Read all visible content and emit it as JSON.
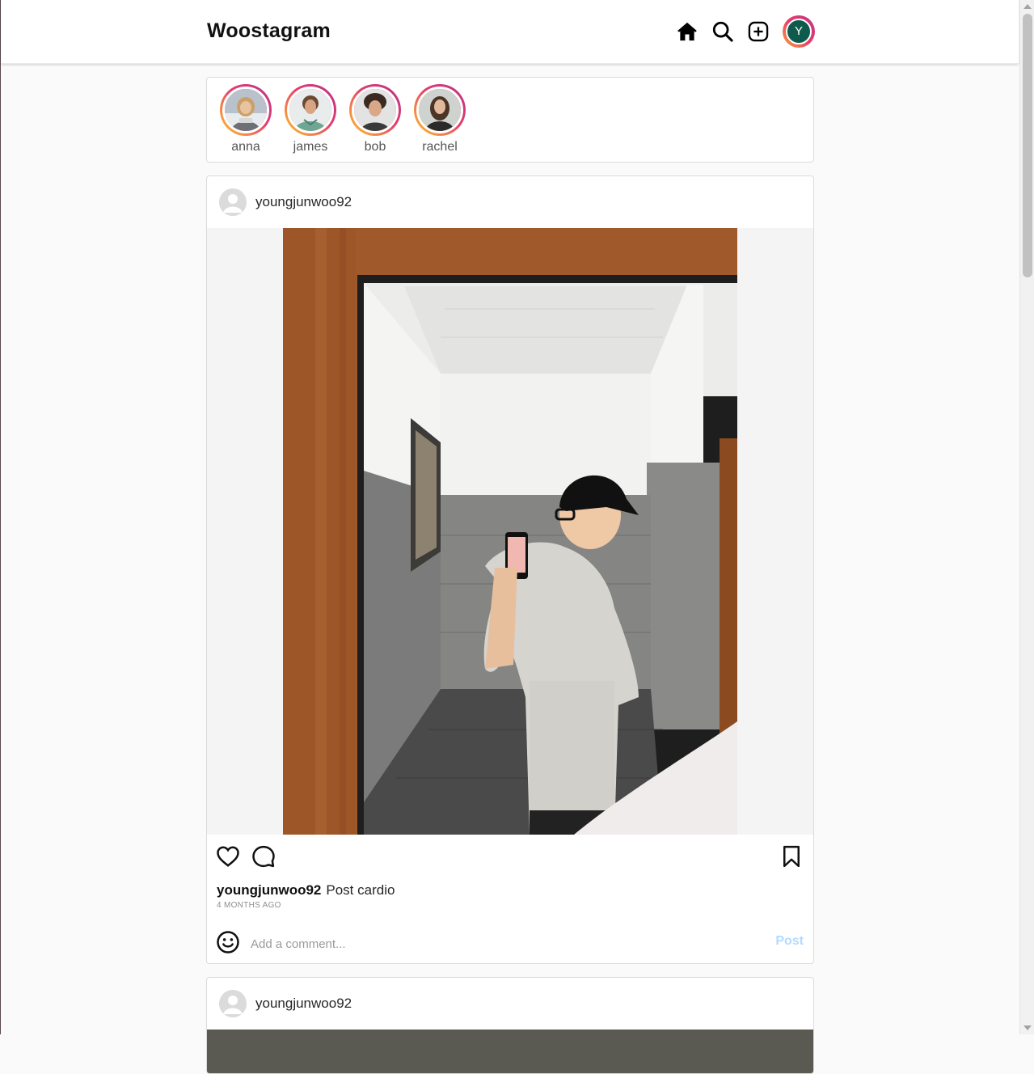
{
  "header": {
    "logo": "Woostagram",
    "icons": [
      "home-icon",
      "search-icon",
      "create-post-icon"
    ],
    "profile_initial": "Y"
  },
  "stories": [
    {
      "name": "anna"
    },
    {
      "name": "james"
    },
    {
      "name": "bob"
    },
    {
      "name": "rachel"
    }
  ],
  "posts": [
    {
      "username": "youngjunwoo92",
      "caption_user": "youngjunwoo92",
      "caption": "Post cardio",
      "time_ago": "4 MONTHS AGO",
      "comment_placeholder": "Add a comment...",
      "post_button": "Post"
    },
    {
      "username": "youngjunwoo92"
    }
  ],
  "colors": {
    "accent_post_button": "#b3dbff",
    "story_ring": [
      "#f9a43a",
      "#e63d6b",
      "#c13584"
    ],
    "profile_avatar_bg": "#0e5a4c"
  }
}
